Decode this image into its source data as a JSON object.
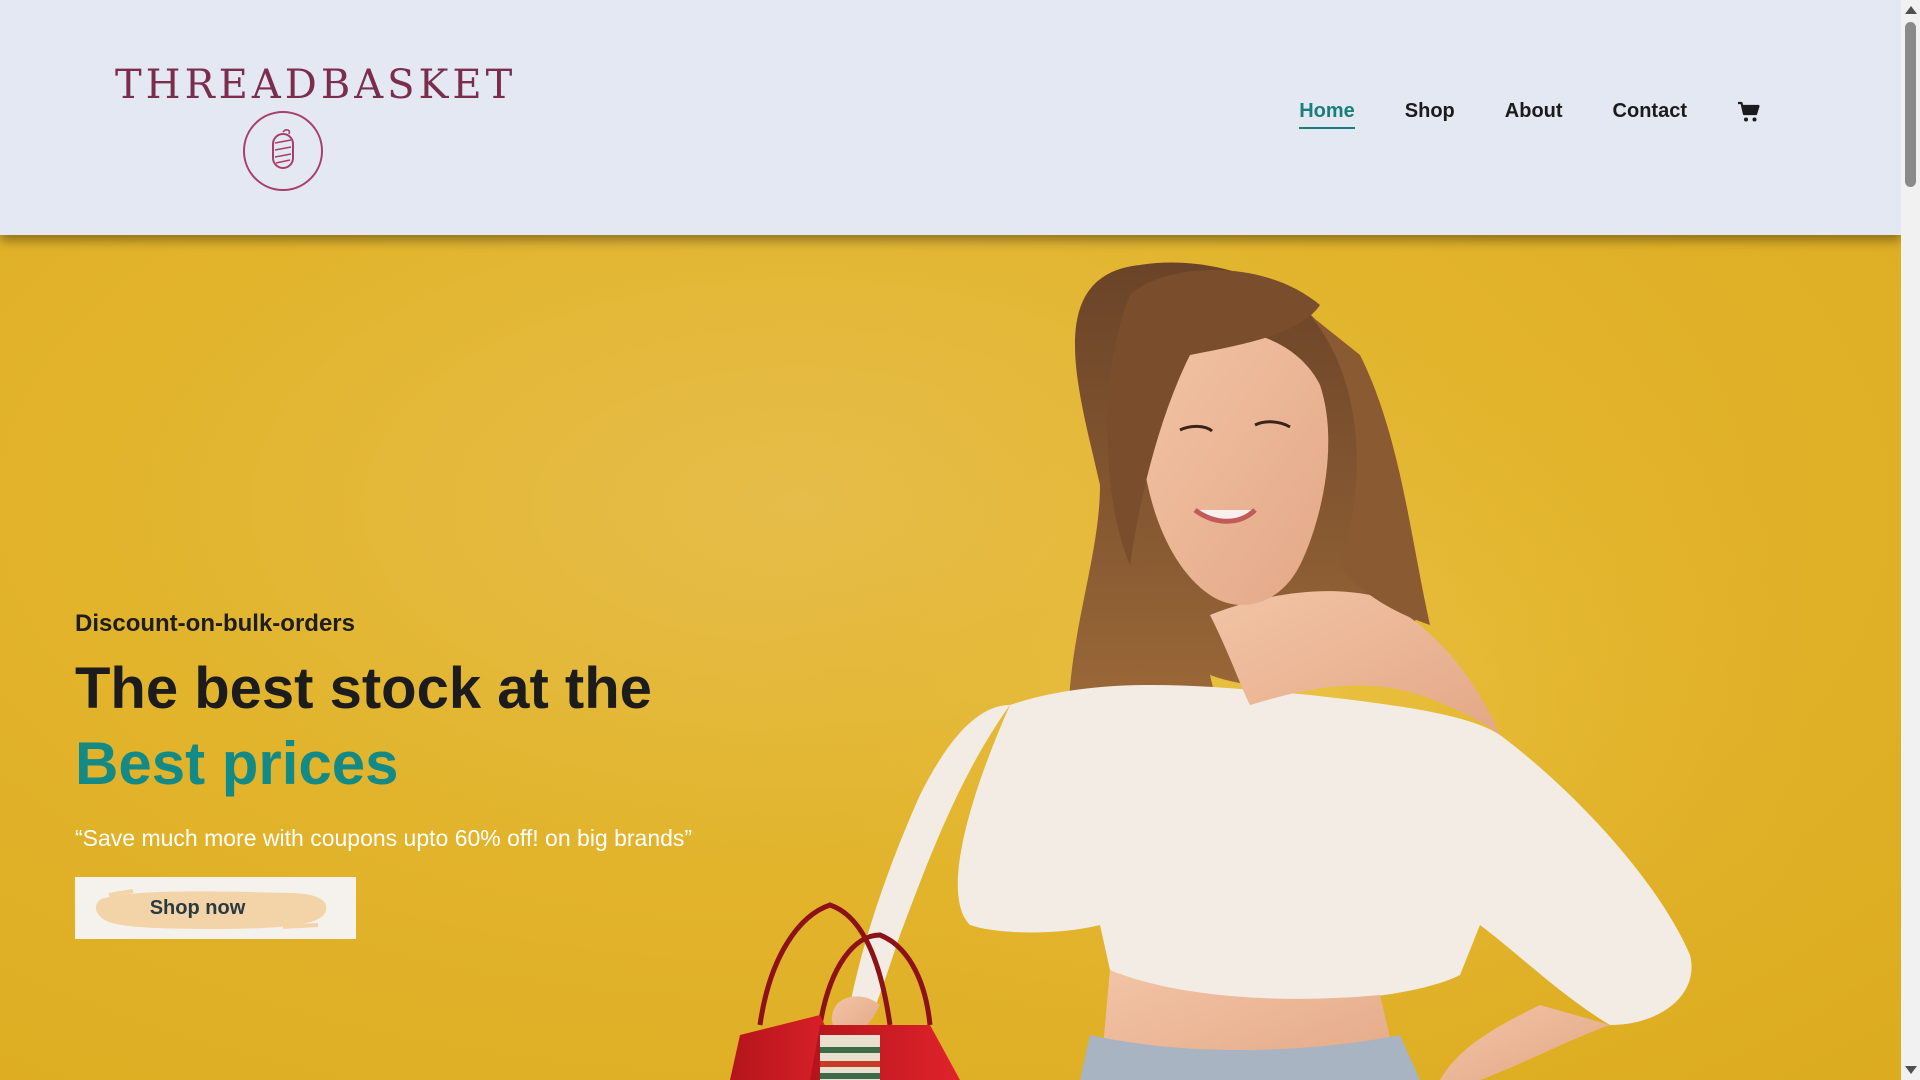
{
  "brand": {
    "name": "THREADBASKET",
    "color": "#7b2d4d"
  },
  "nav": {
    "items": [
      {
        "label": "Home",
        "active": true
      },
      {
        "label": "Shop",
        "active": false
      },
      {
        "label": "About",
        "active": false
      },
      {
        "label": "Contact",
        "active": false
      }
    ],
    "cart_icon": "cart-icon",
    "active_color": "#1a7f7c"
  },
  "hero": {
    "eyebrow": "Discount-on-bulk-orders",
    "headline_line1": "The best stock at the",
    "headline_line2": "Best prices",
    "tagline": "“Save much more with coupons upto 60% off! on big brands”",
    "cta_label": "Shop now",
    "background_color": "#e3b62e",
    "accent_color": "#138a85"
  },
  "header": {
    "background_color": "#e3e8f3"
  }
}
